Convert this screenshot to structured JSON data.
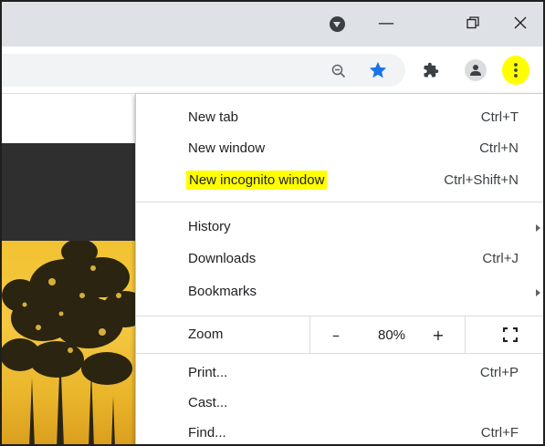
{
  "titlebar": {
    "minimize_glyph": "—",
    "restore_glyph": "⧉",
    "close_glyph": "✕"
  },
  "toolbar": {
    "icons": [
      "zoom-out-icon",
      "star-icon",
      "extensions-puzzle-icon",
      "profile-avatar-icon",
      "kebab-menu-icon"
    ]
  },
  "menu": {
    "new_tab": {
      "label": "New tab",
      "shortcut": "Ctrl+T"
    },
    "new_window": {
      "label": "New window",
      "shortcut": "Ctrl+N"
    },
    "new_incognito": {
      "label": "New incognito window",
      "shortcut": "Ctrl+Shift+N"
    },
    "history": {
      "label": "History"
    },
    "downloads": {
      "label": "Downloads",
      "shortcut": "Ctrl+J"
    },
    "bookmarks": {
      "label": "Bookmarks"
    },
    "zoom": {
      "label": "Zoom",
      "minus": "–",
      "value": "80%",
      "plus": "+"
    },
    "print": {
      "label": "Print...",
      "shortcut": "Ctrl+P"
    },
    "cast": {
      "label": "Cast..."
    },
    "find": {
      "label": "Find...",
      "shortcut": "Ctrl+F"
    }
  },
  "colors": {
    "highlight": "#ffff00",
    "star_blue": "#1a73e8",
    "titlebar_bg": "#dee1e6"
  }
}
